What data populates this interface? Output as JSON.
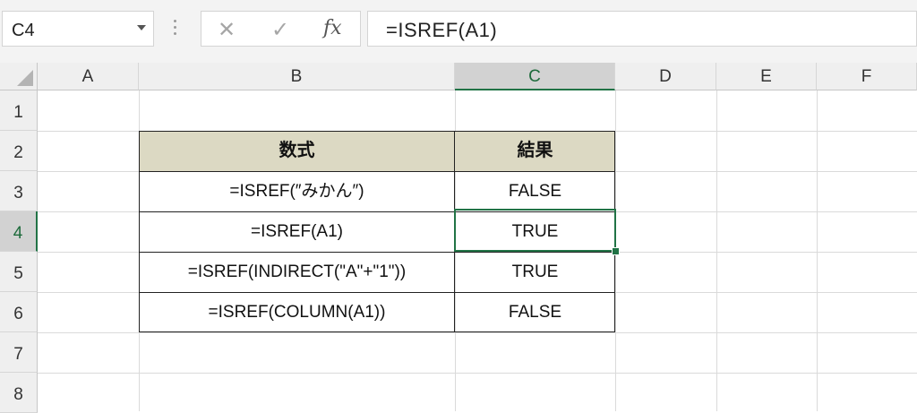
{
  "name_box": {
    "value": "C4"
  },
  "formula_bar": {
    "cancel_glyph": "✕",
    "enter_glyph": "✓",
    "fx_label": "fx",
    "formula": "=ISREF(A1)"
  },
  "columns": [
    "A",
    "B",
    "C",
    "D",
    "E",
    "F"
  ],
  "rows": [
    "1",
    "2",
    "3",
    "4",
    "5",
    "6",
    "7",
    "8"
  ],
  "active_cell": {
    "column": "C",
    "row": "4"
  },
  "table": {
    "headers": [
      "数式",
      "結果"
    ],
    "rows": [
      {
        "formula": "=ISREF(″みかん″)",
        "result": "FALSE"
      },
      {
        "formula": "=ISREF(A1)",
        "result": "TRUE"
      },
      {
        "formula": "=ISREF(INDIRECT(\"A\"+\"1\"))",
        "result": "TRUE"
      },
      {
        "formula": "=ISREF(COLUMN(A1))",
        "result": "FALSE"
      }
    ]
  },
  "colors": {
    "header_fill": "#dcd9c3",
    "selection": "#217346"
  }
}
